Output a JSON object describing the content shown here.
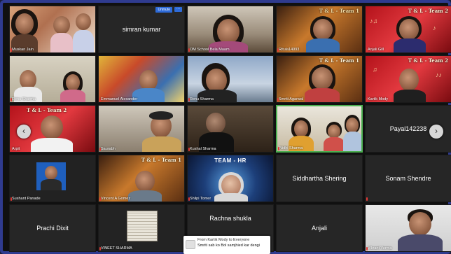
{
  "toolbar": {
    "unmute_label": "Unmute",
    "more_label": "···"
  },
  "tiles": [
    {
      "name": "Muskan Jain"
    },
    {
      "name": "simran kumar"
    },
    {
      "name": "OM School Bela Maam"
    },
    {
      "name": "Ritula14993"
    },
    {
      "name": "Anjali Gill",
      "overlay": "T & L - Team 2"
    },
    {
      "name": "Renu Sharma"
    },
    {
      "name": "Emmanuel Alexander"
    },
    {
      "name": "Renu Sharma"
    },
    {
      "name": "Smriti Agarwal",
      "overlay": "T & L - Team 1"
    },
    {
      "name": "Kartik Mody",
      "overlay": "T & L - Team 2"
    },
    {
      "name": "Arpit",
      "overlay": "T & L - Team 2"
    },
    {
      "name": "Saurabh"
    },
    {
      "name": "Kushal Sharma"
    },
    {
      "name": "Nidhi Sharma"
    },
    {
      "name": "Payal142238"
    },
    {
      "name": "Sushant Panade"
    },
    {
      "name": "Vincent A Gomez",
      "overlay": "T & L - Team 1"
    },
    {
      "name": "Shilpi Tomer",
      "overlay": "TEAM - HR"
    },
    {
      "name": "Siddhartha Shering"
    },
    {
      "name": "Sonam Shendre"
    },
    {
      "name": "Prachi Dixit"
    },
    {
      "name": "VINEET SHARMA"
    },
    {
      "name": "Rachna shukla"
    },
    {
      "name": "Anjali"
    },
    {
      "name": "Vikrant Verma"
    }
  ],
  "chat": {
    "from": "From Kartik Mody to Everyone",
    "message": "Smriti sab ko Bol samjhied kar dengi"
  },
  "nav": {
    "prev": "‹",
    "next": "›"
  }
}
